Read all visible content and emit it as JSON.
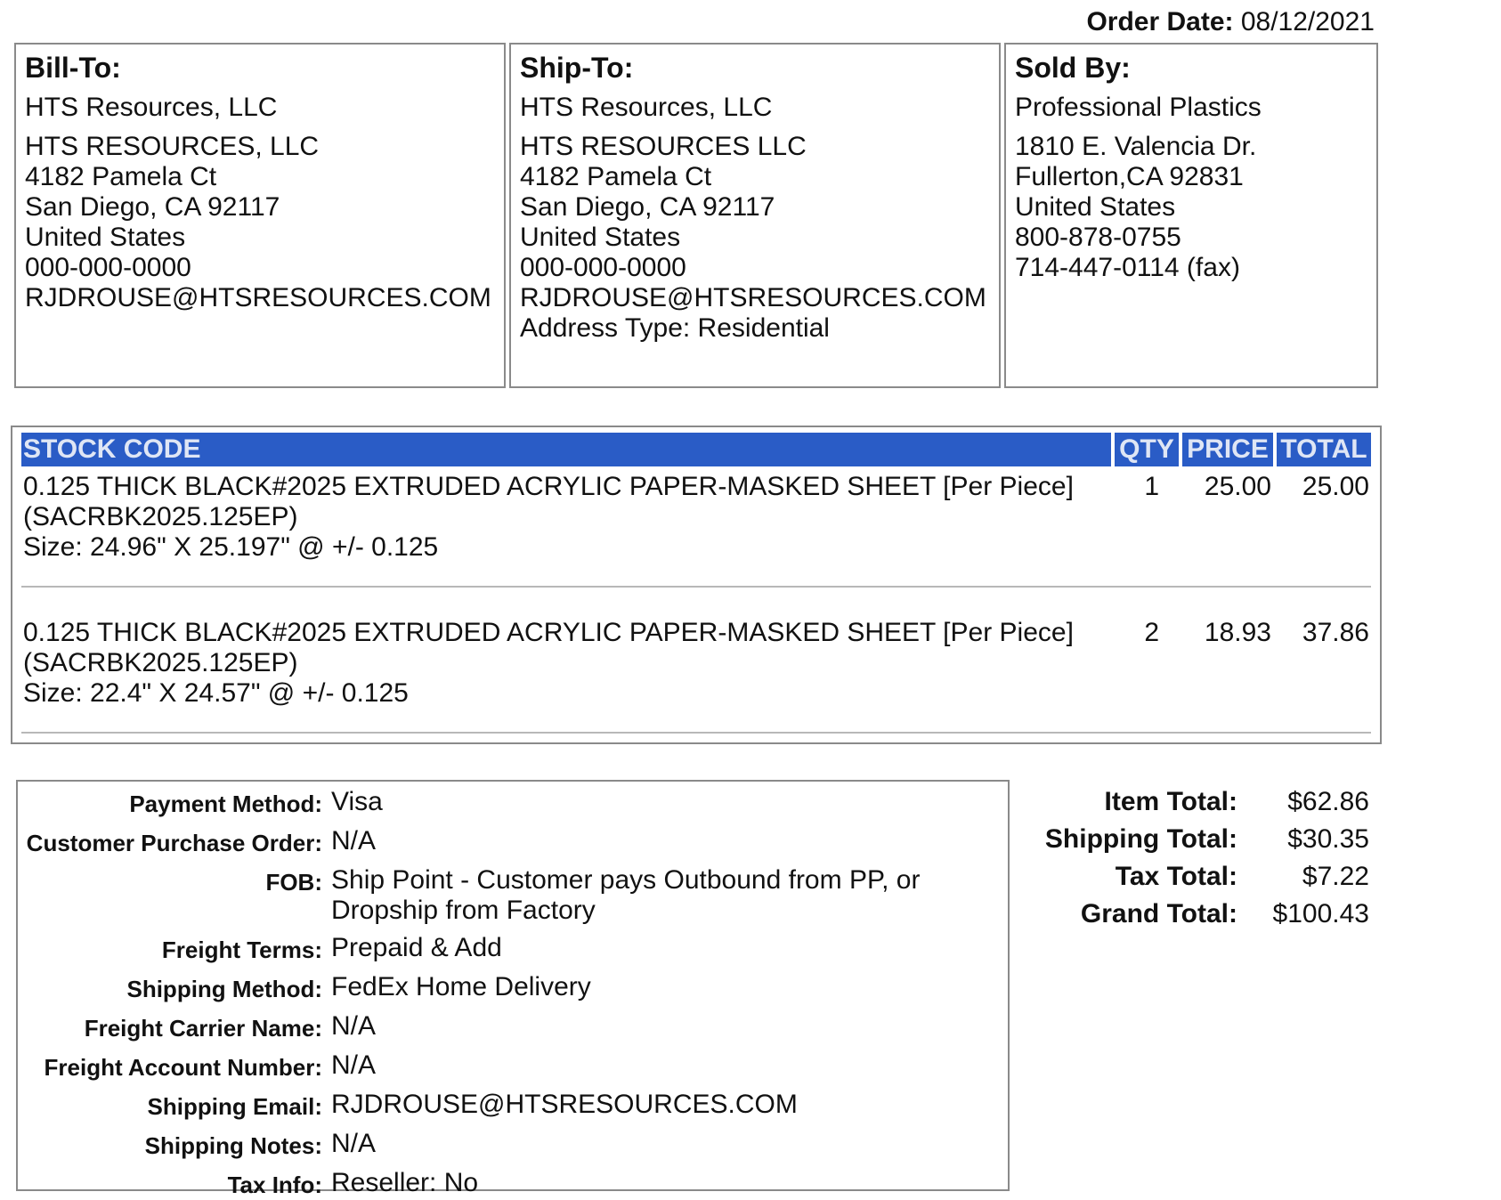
{
  "order_date": {
    "label": "Order Date:",
    "value": "08/12/2021"
  },
  "bill_to": {
    "heading": "Bill-To:",
    "company": "HTS Resources, LLC",
    "lines": [
      "HTS RESOURCES, LLC",
      "4182 Pamela Ct",
      "San Diego, CA 92117",
      "United States",
      "000-000-0000",
      "RJDROUSE@HTSRESOURCES.COM"
    ]
  },
  "ship_to": {
    "heading": "Ship-To:",
    "company": "HTS Resources, LLC",
    "lines": [
      "HTS RESOURCES LLC",
      "4182 Pamela Ct",
      "San Diego, CA 92117",
      "United States",
      "000-000-0000",
      "RJDROUSE@HTSRESOURCES.COM",
      "Address Type: Residential"
    ]
  },
  "sold_by": {
    "heading": "Sold By:",
    "company": "Professional Plastics",
    "lines": [
      "1810 E. Valencia Dr.",
      "Fullerton,CA 92831",
      "United States",
      "800-878-0755",
      "714-447-0114 (fax)"
    ]
  },
  "items_table": {
    "headers": {
      "stock_code": "STOCK CODE",
      "qty": "QTY",
      "price": "PRICE",
      "total": "TOTAL"
    },
    "rows": [
      {
        "desc": "0.125 THICK BLACK#2025 EXTRUDED ACRYLIC PAPER-MASKED SHEET [Per Piece]",
        "code": "(SACRBK2025.125EP)",
        "size": "Size: 24.96\" X 25.197\" @ +/- 0.125",
        "qty": "1",
        "price": "25.00",
        "total": "25.00"
      },
      {
        "desc": "0.125 THICK BLACK#2025 EXTRUDED ACRYLIC PAPER-MASKED SHEET [Per Piece]",
        "code": "(SACRBK2025.125EP)",
        "size": "Size: 22.4\" X 24.57\" @ +/- 0.125",
        "qty": "2",
        "price": "18.93",
        "total": "37.86"
      }
    ]
  },
  "details": [
    {
      "label": "Payment Method:",
      "value": "Visa"
    },
    {
      "label": "Customer Purchase Order:",
      "value": "N/A"
    },
    {
      "label": "FOB:",
      "value": "Ship Point - Customer pays Outbound from PP, or Dropship from Factory"
    },
    {
      "label": "Freight Terms:",
      "value": "Prepaid & Add"
    },
    {
      "label": "Shipping Method:",
      "value": "FedEx Home Delivery"
    },
    {
      "label": "Freight Carrier Name:",
      "value": "N/A"
    },
    {
      "label": "Freight Account Number:",
      "value": "N/A"
    },
    {
      "label": "Shipping Email:",
      "value": "RJDROUSE@HTSRESOURCES.COM"
    },
    {
      "label": "Shipping Notes:",
      "value": "N/A"
    },
    {
      "label": "Tax Info:",
      "value": "Reseller: No"
    }
  ],
  "totals": [
    {
      "label": "Item Total:",
      "value": "$62.86"
    },
    {
      "label": "Shipping Total:",
      "value": "$30.35"
    },
    {
      "label": "Tax Total:",
      "value": "$7.22"
    },
    {
      "label": "Grand Total:",
      "value": "$100.43"
    }
  ]
}
